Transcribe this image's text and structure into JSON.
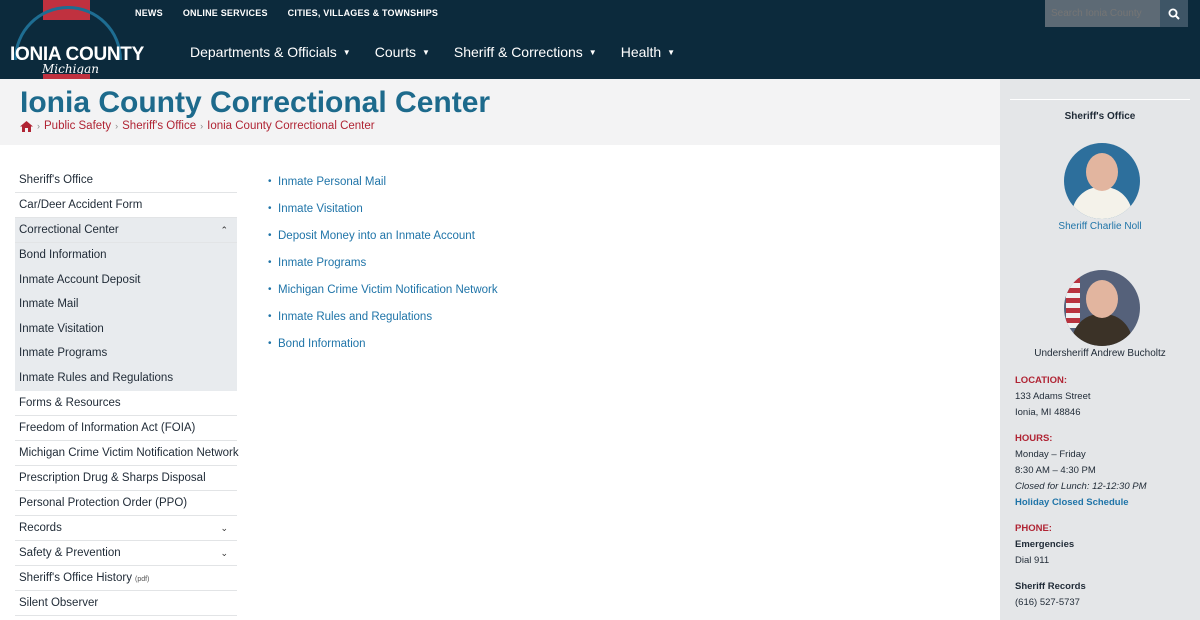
{
  "site": {
    "logo_name": "IONIA COUNTY",
    "logo_script": "Michigan"
  },
  "topnav": [
    "NEWS",
    "ONLINE SERVICES",
    "CITIES, VILLAGES & TOWNSHIPS"
  ],
  "search": {
    "placeholder": "Search Ionia County"
  },
  "mainnav": [
    "Departments & Officials",
    "Courts",
    "Sheriff & Corrections",
    "Health"
  ],
  "page": {
    "title": "Ionia County Correctional Center",
    "breadcrumb": [
      "Public Safety",
      "Sheriff's Office",
      "Ionia County Correctional Center"
    ]
  },
  "leftnav": [
    {
      "label": "Sheriff's Office"
    },
    {
      "label": "Car/Deer Accident Form"
    },
    {
      "label": "Correctional Center",
      "expanded": true
    },
    {
      "label": "Bond Information",
      "sub": true
    },
    {
      "label": "Inmate Account Deposit",
      "sub": true
    },
    {
      "label": "Inmate Mail",
      "sub": true
    },
    {
      "label": "Inmate Visitation",
      "sub": true
    },
    {
      "label": "Inmate Programs",
      "sub": true
    },
    {
      "label": "Inmate Rules and Regulations",
      "sub": true
    },
    {
      "label": "Forms & Resources"
    },
    {
      "label": "Freedom of Information Act (FOIA)"
    },
    {
      "label": "Michigan Crime Victim Notification Network"
    },
    {
      "label": "Prescription Drug & Sharps Disposal"
    },
    {
      "label": "Personal Protection Order (PPO)"
    },
    {
      "label": "Records",
      "collapsible": true
    },
    {
      "label": "Safety & Prevention",
      "collapsible": true
    },
    {
      "label": "Sheriff's Office History",
      "note": "(pdf)"
    },
    {
      "label": "Silent Observer"
    }
  ],
  "content_links": [
    "Inmate Personal Mail",
    "Inmate Visitation",
    "Deposit Money into an Inmate Account",
    "Inmate Programs",
    "Michigan Crime Victim Notification Network",
    "Inmate Rules and Regulations",
    "Bond Information"
  ],
  "sidebar": {
    "heading": "Sheriff's Office",
    "sheriff_caption": "Sheriff Charlie Noll",
    "undersheriff_caption": "Undersheriff Andrew Bucholtz",
    "location_label": "LOCATION:",
    "address_line1": "133 Adams Street",
    "address_line2": "Ionia, MI 48846",
    "hours_label": "HOURS:",
    "hours_days": "Monday – Friday",
    "hours_time": "8:30 AM – 4:30 PM",
    "hours_lunch": "Closed for Lunch: 12-12:30 PM",
    "holiday_link": "Holiday Closed Schedule",
    "phone_label": "PHONE:",
    "emergencies_label": "Emergencies",
    "emergencies_value": "Dial 911",
    "records_label": "Sheriff Records",
    "records_value": "(616) 527-5737"
  },
  "colors": {
    "header_bg": "#0c2a3c",
    "title_blue": "#1d6a8c",
    "link_blue": "#1f74a8",
    "accent_red": "#b02434"
  }
}
